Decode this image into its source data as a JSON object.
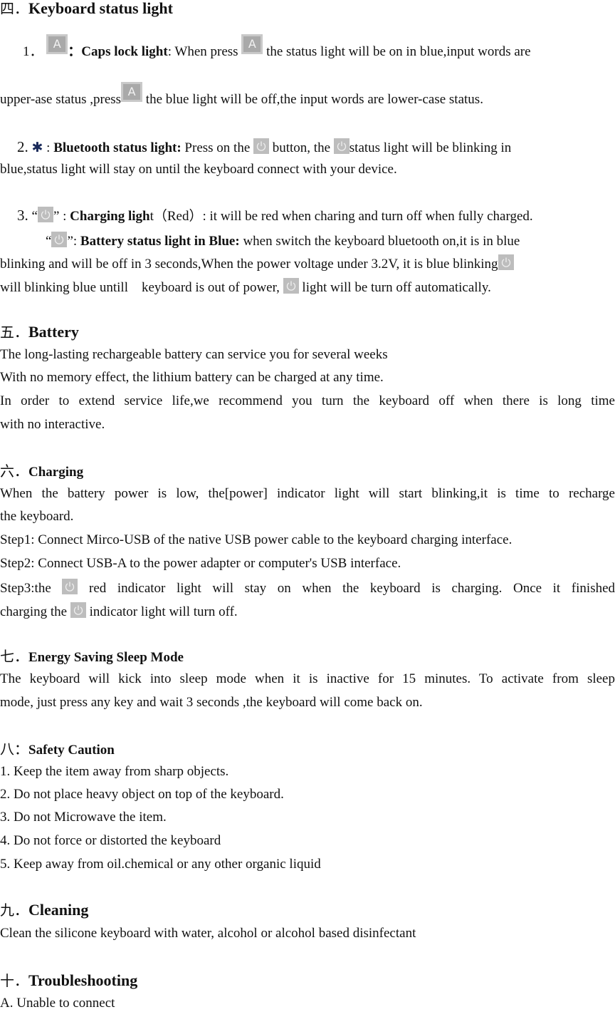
{
  "sections": {
    "s4": {
      "num": "四．",
      "title": "Keyboard status light",
      "item1": {
        "num": "1．",
        "icon": "caps-lock-key-icon",
        "icon_glyph": "A",
        "sep": "：",
        "label": "Caps lock light",
        "text_a": ": When press",
        "text_b": "the status light will be on in blue,input words are",
        "text_c": "upper-ase status ,press",
        "text_d": "the blue light will be off,the input words are lower-case status."
      },
      "item2": {
        "num": "2.",
        "icon": "bluetooth-icon",
        "icon_glyph": "✱",
        "sep": " : ",
        "label": "Bluetooth status light:",
        "text_a": "Press on the",
        "text_b": "button, the",
        "text_c": "status light will be blinking in",
        "text_d": "blue,status light will stay on until the keyboard connect with your device."
      },
      "item3": {
        "num": "3.",
        "quote_open": "“",
        "quote_close": "” : ",
        "label_bold": "Charging ligh",
        "label_rest": "t（Red）",
        "text_a": ": it will be red when charing and turn off when fully charged.",
        "sub_quote_open": "“",
        "sub_quote_close": "”: ",
        "sub_label": "Battery status light in Blue:",
        "sub_text_a": "when switch the keyboard bluetooth on,it is in blue",
        "sub_text_b": "blinking and will be off in 3 seconds,When the power voltage under 3.2V, it is blue blinking",
        "sub_text_c": "will blinking blue untill　keyboard is out of power,",
        "sub_text_d": "light will be turn off automatically."
      }
    },
    "s5": {
      "num": "五．",
      "title": "Battery",
      "lines": [
        "The long-lasting rechargeable battery can service you for several weeks",
        "With no memory effect, the lithium battery can be charged at any time.",
        "In order to extend service life,we recommend you turn the keyboard off when there is long time",
        "with no interactive."
      ]
    },
    "s6": {
      "num": "六．",
      "title": "Charging",
      "lines": [
        "When the battery power is low, the[power] indicator light will start blinking,it is time to recharge",
        "the keyboard.",
        "Step1: Connect Mirco-USB of the native USB power cable to the keyboard charging interface.",
        "Step2: Connect USB-A to the power adapter or computer's USB interface."
      ],
      "step3_a": "Step3:the",
      "step3_b": "red indicator light will stay on when the keyboard is charging. Once it finished",
      "step3_c": "charging the",
      "step3_d": "indicator light will turn off."
    },
    "s7": {
      "num": "七．",
      "title": "Energy Saving Sleep Mode",
      "lines": [
        "The keyboard will kick into sleep mode when it is inactive for 15 minutes. To activate from sleep",
        "mode, just press any key and wait 3 seconds ,the keyboard will come back on."
      ]
    },
    "s8": {
      "num": "八：",
      "title": "Safety Caution",
      "lines": [
        "1. Keep the item away from sharp objects.",
        "2. Do not place heavy object on top of the keyboard.",
        "3. Do not Microwave the item.",
        "4. Do not force or distorted the keyboard",
        "5. Keep away from oil.chemical or any other organic liquid"
      ]
    },
    "s9": {
      "num": "九．",
      "title": "Cleaning",
      "lines": [
        "Clean the silicone keyboard with water, alcohol or alcohol based disinfectant"
      ]
    },
    "s10": {
      "num": "十．",
      "title": "Troubleshooting",
      "lines": [
        "A. Unable to connect"
      ]
    }
  }
}
